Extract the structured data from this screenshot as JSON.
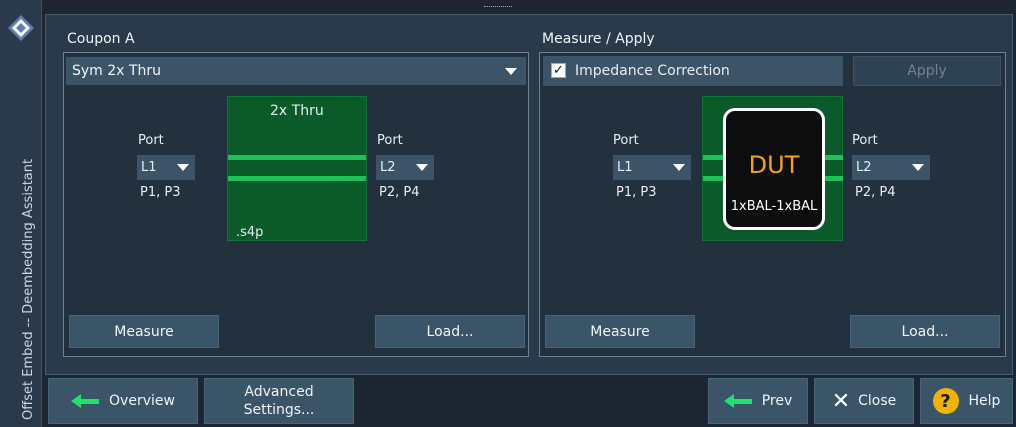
{
  "sidebar": {
    "title": "Offset Embed -- Deembedding Assistant",
    "logo": "rs-logo-icon"
  },
  "coupon": {
    "group_label": "Coupon A",
    "fixture_select": "Sym 2x Thru",
    "left_port_label": "Port",
    "left_port_value": "L1",
    "left_ports": "P1, P3",
    "right_port_label": "Port",
    "right_port_value": "L2",
    "right_ports": "P2, P4",
    "diagram_title": "2x Thru",
    "file_ext": ".s4p",
    "measure_label": "Measure",
    "load_label": "Load..."
  },
  "measure_apply": {
    "group_label": "Measure / Apply",
    "impedance_label": "Impedance Correction",
    "impedance_checked": true,
    "apply_label": "Apply",
    "left_port_label": "Port",
    "left_port_value": "L1",
    "left_ports": "P1, P3",
    "right_port_label": "Port",
    "right_port_value": "L2",
    "right_ports": "P2, P4",
    "dut_label": "DUT",
    "dut_config": "1xBAL-1xBAL",
    "measure_label": "Measure",
    "load_label": "Load..."
  },
  "footer": {
    "overview_label": "Overview",
    "advanced_label_line1": "Advanced",
    "advanced_label_line2": "Settings...",
    "prev_label": "Prev",
    "close_label": "Close",
    "help_label": "Help"
  },
  "colors": {
    "background": "#1c2633",
    "panel": "#2a3a4a",
    "button": "#3a5468",
    "diagram_green": "#0a5a2a",
    "trace_green": "#1fc15a",
    "dut_text": "#f3a21b",
    "help_yellow": "#f0b400"
  }
}
